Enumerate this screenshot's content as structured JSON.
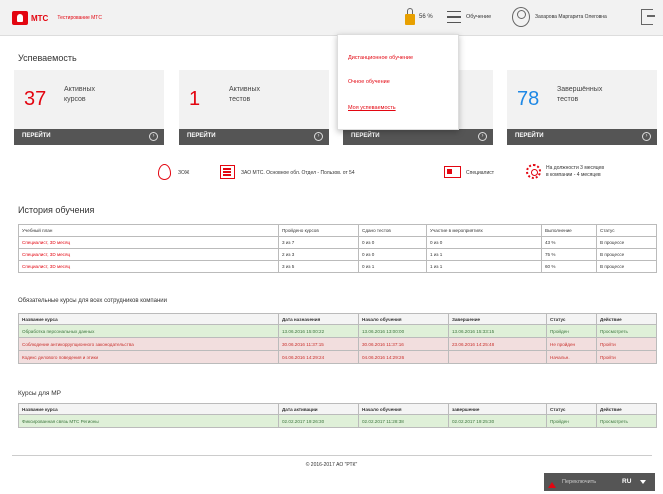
{
  "header": {
    "logo_text": "МТС",
    "logo_subtitle": "Тестирование МТС",
    "battery_percent": "56 %",
    "menu_label": "Обучение",
    "user_name": "Захарова Маргарита Олеговна",
    "accent_color": "#e30611"
  },
  "dropdown": {
    "items": [
      {
        "label": "Дистанционное обучение"
      },
      {
        "label": "Очное обучение"
      },
      {
        "label": "Моя успеваемость"
      }
    ]
  },
  "progress": {
    "title": "Успеваемость",
    "cards": [
      {
        "number": "37",
        "label_line1": "Активных",
        "label_line2": "курсов",
        "button": "ПЕРЕЙТИ"
      },
      {
        "number": "1",
        "label_line1": "Активных",
        "label_line2": "тестов",
        "button": "ПЕРЕЙТИ"
      },
      {
        "number": "",
        "label_line1": "",
        "label_line2": "",
        "button": "ПЕРЕЙТИ"
      },
      {
        "number": "78",
        "label_line1": "Завершённых",
        "label_line2": "тестов",
        "button": "ПЕРЕЙТИ"
      }
    ]
  },
  "info": {
    "drop_text": "ЗОЖ",
    "building_text": "ЗАО МТС. Основное обл. Отдел - Пользов. от 54",
    "id_text": "Специалист",
    "gear_line1": "На должности 3 месяцев",
    "gear_line2": "в компании - 4 месяцев"
  },
  "history": {
    "title": "История обучения",
    "headers": [
      "Учебный план",
      "Пройдено курсов",
      "Сдано тестов",
      "Участие в мероприятиях",
      "Выполнение",
      "Статус"
    ],
    "rows": [
      [
        "Специалист, 3D месяц",
        "3 из 7",
        "0 из 0",
        "0 из 0",
        "43 %",
        "В процессе"
      ],
      [
        "Специалист, 3D месяц",
        "2 из 3",
        "0 из 0",
        "1 из 1",
        "75 %",
        "В процессе"
      ],
      [
        "Специалист, 3D месяц",
        "3 из 5",
        "0 из 1",
        "1 из 1",
        "60 %",
        "В процессе"
      ]
    ]
  },
  "mandatory": {
    "title": "Обязательные курсы для всех сотрудников компании",
    "headers": [
      "Название курса",
      "Дата назначения",
      "Начало обучения",
      "Завершение",
      "Статус",
      "Действие"
    ],
    "rows": [
      {
        "cells": [
          "Обработка персональных данных",
          "13.06.2016 15:00:22",
          "13.06.2016 13:00:00",
          "13.06.2016 15:33:15",
          "Пройден",
          "Просмотреть"
        ]
      },
      {
        "cells": [
          "Соблюдение антикоррупционного законодательства",
          "30.06.2016 11:37:15",
          "30.06.2016 11:37:16",
          "23.06.2016 14:25:48",
          "Не пройден",
          "Пройти"
        ]
      },
      {
        "cells": [
          "Кодекс делового поведения и этики",
          "04.06.2016 14:29:24",
          "04.06.2016 14:29:26",
          "",
          "Начальн.",
          "Пройти"
        ]
      }
    ]
  },
  "mp": {
    "title": "Курсы для МР",
    "headers": [
      "Название курса",
      "Дата активации",
      "Начало обучения",
      "завершение",
      "Статус",
      "Действие"
    ],
    "rows": [
      {
        "cells": [
          "Фиксированная связь МТС Регионы",
          "02.02.2017 19:26:30",
          "02.02.2017 11:28:38",
          "02.02.2017 19:25:30",
          "Пройден",
          "Просмотреть"
        ]
      }
    ]
  },
  "footer": {
    "copyright": "© 2016-2017 АО \"РТК\"",
    "language_label": "Переключить",
    "language_code": "RU"
  }
}
